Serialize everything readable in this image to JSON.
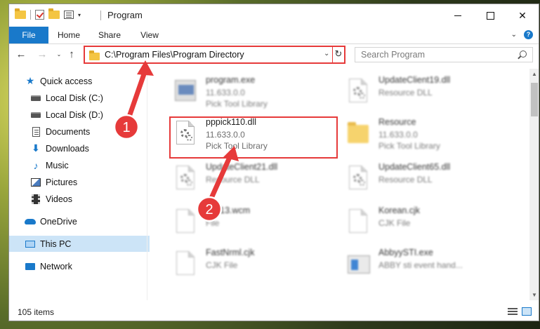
{
  "window": {
    "title": "Program",
    "controls": {
      "minimize": "minimize",
      "maximize": "maximize",
      "close": "✕"
    }
  },
  "ribbon": {
    "tabs": [
      "File",
      "Home",
      "Share",
      "View"
    ]
  },
  "nav": {
    "address": "C:\\Program Files\\Program Directory",
    "search_placeholder": "Search Program"
  },
  "sidebar": {
    "items": [
      {
        "label": "Quick access",
        "icon": "star-icon",
        "pinned": false
      },
      {
        "label": "Local Disk (C:)",
        "icon": "disk-icon",
        "pinned": true
      },
      {
        "label": "Local Disk (D:)",
        "icon": "disk-icon",
        "pinned": true
      },
      {
        "label": "Documents",
        "icon": "documents-icon",
        "pinned": true
      },
      {
        "label": "Downloads",
        "icon": "downloads-icon",
        "pinned": true
      },
      {
        "label": "Music",
        "icon": "music-icon",
        "pinned": true
      },
      {
        "label": "Pictures",
        "icon": "pictures-icon",
        "pinned": true
      },
      {
        "label": "Videos",
        "icon": "videos-icon",
        "pinned": true
      },
      {
        "label": "OneDrive",
        "icon": "onedrive-icon",
        "pinned": false
      },
      {
        "label": "This PC",
        "icon": "this-pc-icon",
        "pinned": false,
        "selected": true
      },
      {
        "label": "Network",
        "icon": "network-icon",
        "pinned": false
      }
    ]
  },
  "files": [
    {
      "name": "program.exe",
      "line1": "11.633.0.0",
      "line2": "Pick Tool Library",
      "icon": "exe-icon",
      "blurred": true
    },
    {
      "name": "UpdateClient19.dll",
      "line1": "Resource DLL",
      "line2": "",
      "icon": "dll-file-icon",
      "blurred": true
    },
    {
      "name": "pppick110.dll",
      "line1": "11.633.0.0",
      "line2": "Pick Tool Library",
      "icon": "dll-gear-icon",
      "blurred": false
    },
    {
      "name": "Resource",
      "line1": "11.633.0.0",
      "line2": "Pick Tool Library",
      "icon": "folder-icon",
      "blurred": true
    },
    {
      "name": "UpdateClient21.dll",
      "line1": "Resource DLL",
      "line2": "",
      "icon": "dll-gear-icon",
      "blurred": true
    },
    {
      "name": "UpdateClient65.dll",
      "line1": "Resource DLL",
      "line2": "",
      "icon": "dll-gear-icon",
      "blurred": true
    },
    {
      "name": "WP13.wcm",
      "line1": "File",
      "line2": "",
      "icon": "blank-file-icon",
      "blurred": true
    },
    {
      "name": "Korean.cjk",
      "line1": "CJK File",
      "line2": "",
      "icon": "blank-file-icon",
      "blurred": true
    },
    {
      "name": "FastNrml.cjk",
      "line1": "CJK File",
      "line2": "",
      "icon": "blank-file-icon",
      "blurred": true
    },
    {
      "name": "AbbyySTI.exe",
      "line1": "ABBY sti event hand...",
      "line2": "",
      "icon": "app-icon",
      "blurred": true
    }
  ],
  "status": {
    "item_count": "105 items"
  },
  "annotations": {
    "step1": "1",
    "step2": "2",
    "color": "#e63a3a"
  }
}
